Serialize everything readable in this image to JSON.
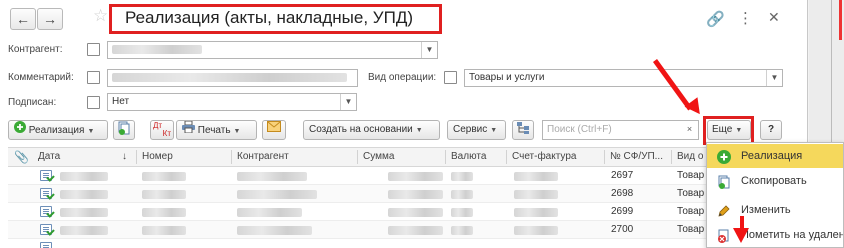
{
  "window": {
    "title": "Реализация (акты, накладные, УПД)"
  },
  "filters": {
    "counterparty_label": "Контрагент:",
    "comment_label": "Комментарий:",
    "operation_label": "Вид операции:",
    "operation_value": "Товары и услуги",
    "signed_label": "Подписан:",
    "signed_value": "Нет"
  },
  "toolbar": {
    "realization_label": "Реализация",
    "print_label": "Печать",
    "based_on_label": "Создать на основании",
    "service_label": "Сервис",
    "search_placeholder": "Поиск (Ctrl+F)",
    "search_clear": "×",
    "more_label": "Еще",
    "help_label": "?",
    "dtkt_top": "Дт",
    "dtkt_bottom": "Кт"
  },
  "table": {
    "columns": [
      "Дата",
      "Номер",
      "Контрагент",
      "Сумма",
      "Валюта",
      "Счет-фактура",
      "№ СФ/УП...",
      "Вид о"
    ],
    "sort_indicator": "↓",
    "rows": [
      {
        "sf_number": "2697",
        "kind": "Товар"
      },
      {
        "sf_number": "2698",
        "kind": "Товар"
      },
      {
        "sf_number": "2699",
        "kind": "Товар"
      },
      {
        "sf_number": "2700",
        "kind": "Товар"
      }
    ]
  },
  "more_menu": {
    "items": [
      {
        "label": "Реализация",
        "icon": "plus-circle-icon",
        "selected": true
      },
      {
        "label": "Скопировать",
        "icon": "copy-icon",
        "selected": false
      },
      {
        "label": "Изменить",
        "icon": "pencil-icon",
        "selected": false
      },
      {
        "label": "Пометить на удален",
        "icon": "delete-mark-icon",
        "selected": false
      }
    ]
  },
  "colors": {
    "highlight": "#e02020",
    "menu_selected": "#f5d85c",
    "plus_icon": "#3aaa35"
  }
}
